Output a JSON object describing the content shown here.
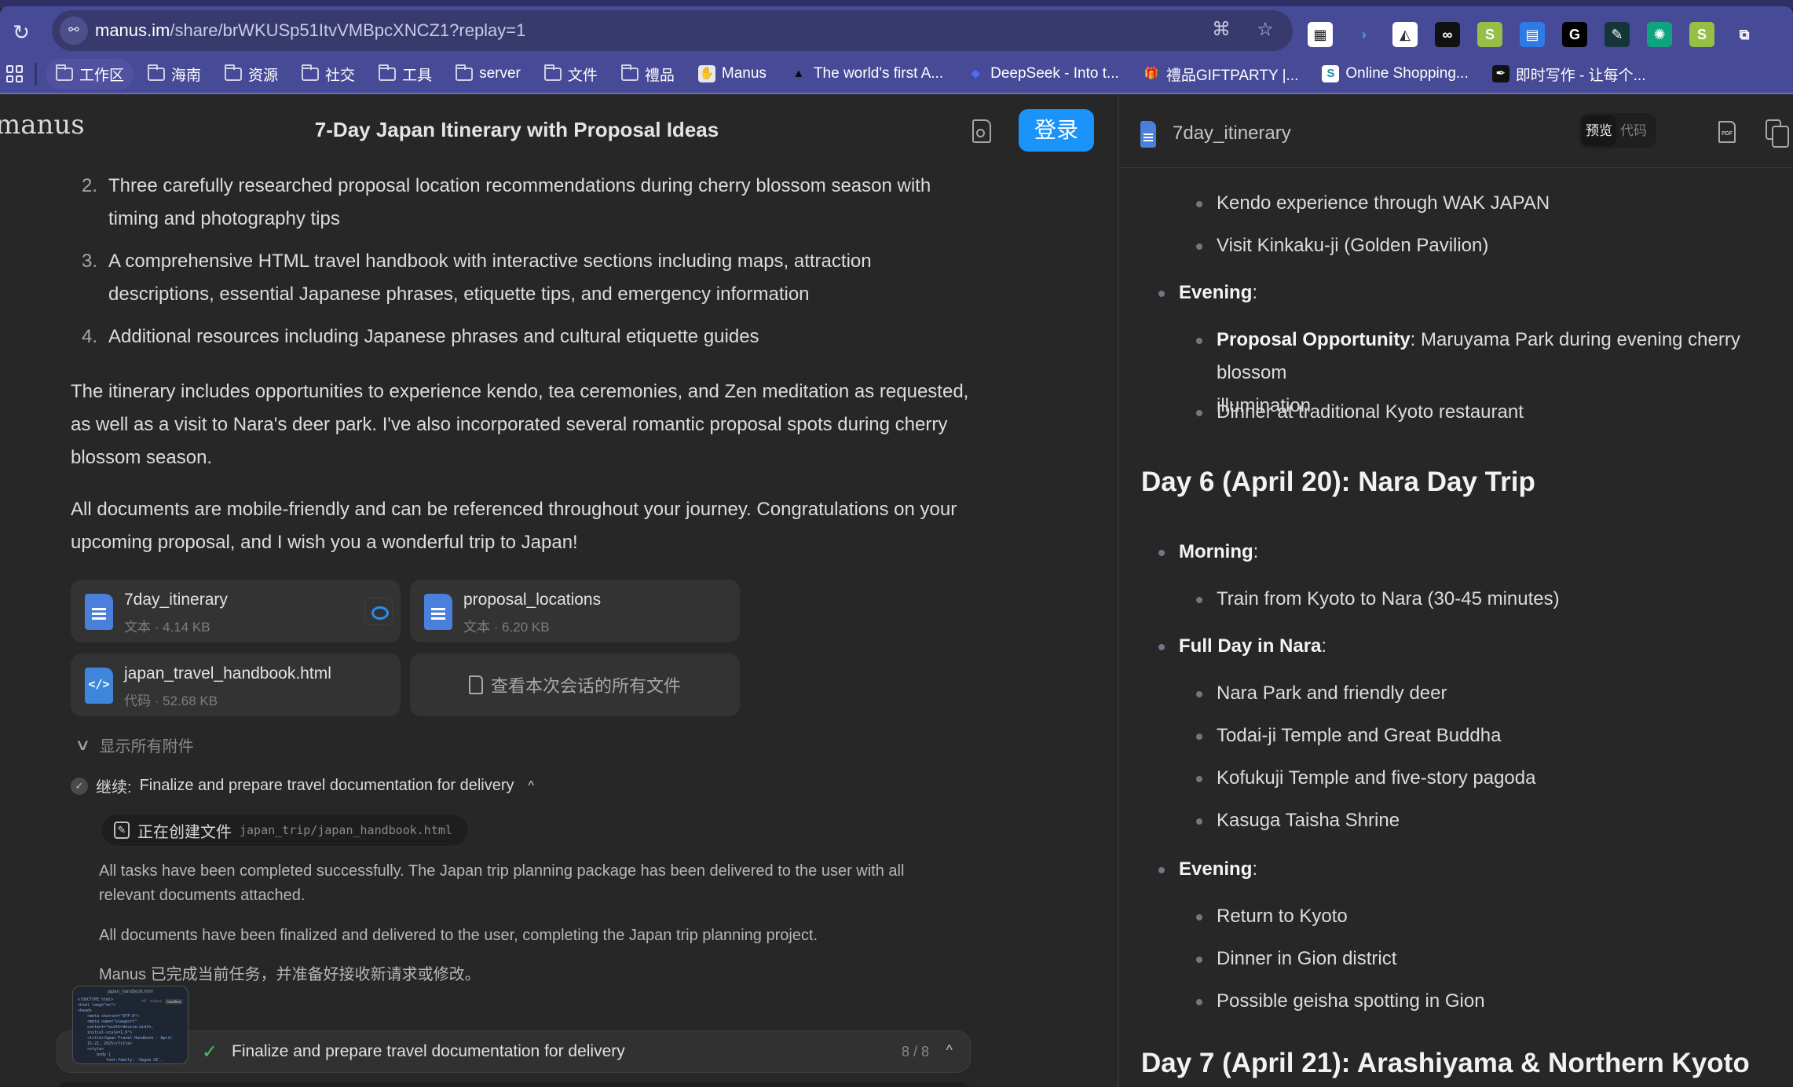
{
  "browser": {
    "url_host": "manus.im",
    "url_path": "/share/brWKUSp51ItvVMBpcXNCZ1?replay=1",
    "url_actions": [
      "translate-icon",
      "bookmark-star-icon"
    ],
    "extensions": [
      {
        "name": "qr-code-extension",
        "glyph": "▦",
        "bg": "#ffffff",
        "fg": "#222222"
      },
      {
        "name": "sync-extension",
        "glyph": "◑",
        "bg": "transparent",
        "fg": "#3b8fe0"
      },
      {
        "name": "shark-extension",
        "glyph": "◭",
        "bg": "#ffffff",
        "fg": "#333333"
      },
      {
        "name": "glasses-extension",
        "glyph": "∞",
        "bg": "#111111",
        "fg": "#ffffff"
      },
      {
        "name": "shopify-extension",
        "glyph": "S",
        "bg": "#95bf47",
        "fg": "#ffffff"
      },
      {
        "name": "contact-card-extension",
        "glyph": "▤",
        "bg": "#2e7be8",
        "fg": "#ffffff"
      },
      {
        "name": "g-extension",
        "glyph": "G",
        "bg": "#000000",
        "fg": "#ffffff"
      },
      {
        "name": "pen-tool-extension",
        "glyph": "✎",
        "bg": "#14363a",
        "fg": "#ffffff"
      },
      {
        "name": "chatgpt-extension",
        "glyph": "✺",
        "bg": "#10a37f",
        "fg": "#ffffff"
      },
      {
        "name": "shopify-s-extension",
        "glyph": "S",
        "bg": "#95bf47",
        "fg": "#ffffff"
      },
      {
        "name": "extensions-puzzle",
        "glyph": "⧉",
        "bg": "transparent",
        "fg": "#ffffff"
      }
    ],
    "bookmarks": [
      {
        "label": "工作区",
        "type": "folder",
        "active": true
      },
      {
        "label": "海南",
        "type": "folder"
      },
      {
        "label": "资源",
        "type": "folder"
      },
      {
        "label": "社交",
        "type": "folder"
      },
      {
        "label": "工具",
        "type": "folder"
      },
      {
        "label": "server",
        "type": "folder"
      },
      {
        "label": "文件",
        "type": "folder"
      },
      {
        "label": "禮品",
        "type": "folder"
      },
      {
        "label": "Manus",
        "type": "site",
        "glyph": "✋",
        "bg": "#e8e8e8",
        "fg": "#333"
      },
      {
        "label": "The world's first A...",
        "type": "site",
        "glyph": "▲",
        "bg": "transparent",
        "fg": "#0b0b0b"
      },
      {
        "label": "DeepSeek - Into t...",
        "type": "site",
        "glyph": "◆",
        "bg": "transparent",
        "fg": "#4d6bfe"
      },
      {
        "label": "禮品GIFTPARTY |...",
        "type": "site",
        "glyph": "🎁",
        "bg": "transparent",
        "fg": "#e04040"
      },
      {
        "label": "Online Shopping...",
        "type": "site",
        "glyph": "S",
        "bg": "#ffffff",
        "fg": "#1a8fb0"
      },
      {
        "label": "即时写作 - 让每个...",
        "type": "site",
        "glyph": "✒",
        "bg": "#111111",
        "fg": "#ffffff"
      }
    ]
  },
  "left": {
    "brand": "manus",
    "title": "7-Day Japan Itinerary with Proposal Ideas",
    "login_label": "登录",
    "list_items": [
      {
        "num": "2.",
        "text": "Three carefully researched proposal location recommendations during cherry blossom season with timing and photography tips"
      },
      {
        "num": "3.",
        "text": "A comprehensive HTML travel handbook with interactive sections including maps, attraction descriptions, essential Japanese phrases, etiquette tips, and emergency information"
      },
      {
        "num": "4.",
        "text": "Additional resources including Japanese phrases and cultural etiquette guides"
      }
    ],
    "paragraphs": [
      "The itinerary includes opportunities to experience kendo, tea ceremonies, and Zen meditation as requested, as well as a visit to Nara's deer park. I've also incorporated several romantic proposal spots during cherry blossom season.",
      "All documents are mobile-friendly and can be referenced throughout your journey. Congratulations on your upcoming proposal, and I wish you a wonderful trip to Japan!"
    ],
    "files": [
      {
        "name": "7day_itinerary",
        "meta": "文本 · 4.14 KB",
        "kind": "doc"
      },
      {
        "name": "proposal_locations",
        "meta": "文本 · 6.20 KB",
        "kind": "doc"
      },
      {
        "name": "japan_travel_handbook.html",
        "meta": "代码 · 52.68 KB",
        "kind": "code"
      }
    ],
    "view_all_files": "查看本次会话的所有文件",
    "show_all_attachments": "显示所有附件",
    "step": {
      "prefix": "继续:",
      "title": "Finalize and prepare travel documentation for delivery"
    },
    "tool_call": {
      "action": "正在创建文件",
      "path": "japan_trip/japan_handbook.html"
    },
    "results": [
      "All tasks have been completed successfully. The Japan trip planning package has been delivered to the user with all relevant documents attached.",
      "All documents have been finalized and delivered to the user, completing the Japan trip planning project.",
      "Manus 已完成当前任务，并准备好接收新请求或修改。"
    ],
    "thumbnail": {
      "title": "japan_handbook.html",
      "tabs": [
        "Diff",
        "Original",
        "Modified"
      ],
      "code": "<!DOCTYPE html>\n<html lang=\"en\">\n<head>\n    <meta charset=\"UTF-8\">\n    <meta name=\"viewport\"\n    content=\"width=device-width,\n    initial-scale=1.0\">\n    <title>Japan Travel Handbook - April\n    15-21, 2025</title>\n    <style>\n        body {\n            font-family: 'Segoe UI',"
    },
    "progress": {
      "label": "Finalize and prepare travel documentation for delivery",
      "count": "8 / 8",
      "completed": 8,
      "total": 8
    }
  },
  "right": {
    "file_title": "7day_itinerary",
    "view_tabs": [
      {
        "label": "预览",
        "active": true
      },
      {
        "label": "代码",
        "active": false
      }
    ],
    "doc": [
      {
        "level": 2,
        "text": "Kendo experience through WAK JAPAN"
      },
      {
        "level": 2,
        "text": "Visit Kinkaku-ji (Golden Pavilion)"
      },
      {
        "level": 1,
        "bold": "Evening",
        "text": ":"
      },
      {
        "level": 2,
        "bold": "Proposal Opportunity",
        "text": ": Maruyama Park during evening cherry blossom",
        "cont": "illumination"
      },
      {
        "level": 2,
        "text": "Dinner at traditional Kyoto restaurant"
      },
      {
        "level": 0,
        "text": "Day 6 (April 20): Nara Day Trip"
      },
      {
        "level": 1,
        "bold": "Morning",
        "text": ":"
      },
      {
        "level": 2,
        "text": "Train from Kyoto to Nara (30-45 minutes)"
      },
      {
        "level": 1,
        "bold": "Full Day in Nara",
        "text": ":"
      },
      {
        "level": 2,
        "text": "Nara Park and friendly deer"
      },
      {
        "level": 2,
        "text": "Todai-ji Temple and Great Buddha"
      },
      {
        "level": 2,
        "text": "Kofukuji Temple and five-story pagoda"
      },
      {
        "level": 2,
        "text": "Kasuga Taisha Shrine"
      },
      {
        "level": 1,
        "bold": "Evening",
        "text": ":"
      },
      {
        "level": 2,
        "text": "Return to Kyoto"
      },
      {
        "level": 2,
        "text": "Dinner in Gion district"
      },
      {
        "level": 2,
        "text": "Possible geisha spotting in Gion"
      },
      {
        "level": 0,
        "text": "Day 7 (April 21): Arashiyama & Northern Kyoto"
      }
    ]
  }
}
